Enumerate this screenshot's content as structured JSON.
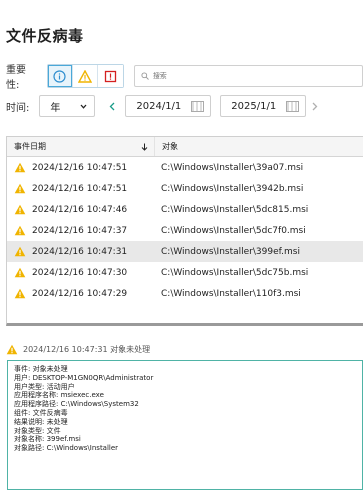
{
  "page": {
    "title": "文件反病毒"
  },
  "filters": {
    "severity_label": "重要性:",
    "search_placeholder": "搜索",
    "time_label": "时间:",
    "period": "年",
    "start_date": "2024/1/1",
    "end_date": "2025/1/1"
  },
  "table": {
    "columns": [
      "事件日期",
      "对象"
    ],
    "rows": [
      {
        "date": "2024/12/16 10:47:51",
        "object": "C:\\Windows\\Installer\\39a07.msi"
      },
      {
        "date": "2024/12/16 10:47:51",
        "object": "C:\\Windows\\Installer\\3942b.msi"
      },
      {
        "date": "2024/12/16 10:47:46",
        "object": "C:\\Windows\\Installer\\5dc815.msi"
      },
      {
        "date": "2024/12/16 10:47:37",
        "object": "C:\\Windows\\Installer\\5dc7f0.msi"
      },
      {
        "date": "2024/12/16 10:47:31",
        "object": "C:\\Windows\\Installer\\399ef.msi"
      },
      {
        "date": "2024/12/16 10:47:30",
        "object": "C:\\Windows\\Installer\\5dc75b.msi"
      },
      {
        "date": "2024/12/16 10:47:29",
        "object": "C:\\Windows\\Installer\\110f3.msi"
      }
    ]
  },
  "detail": {
    "header": "2024/12/16 10:47:31 对象未处理",
    "lines": [
      "事件: 对象未处理",
      "用户: DESKTOP-M1GN0QR\\Administrator",
      "用户类型: 活动用户",
      "应用程序名称: msiexec.exe",
      "应用程序路径: C:\\Windows\\System32",
      "组件: 文件反病毒",
      "结果说明: 未处理",
      "对象类型: 文件",
      "对象名称: 399ef.msi",
      "对象路径: C:\\Windows\\Installer"
    ]
  },
  "colors": {
    "warning": "#f0b400",
    "info": "#2f8fd0",
    "critical": "#d42020",
    "detail_border": "#4fb3a6"
  }
}
